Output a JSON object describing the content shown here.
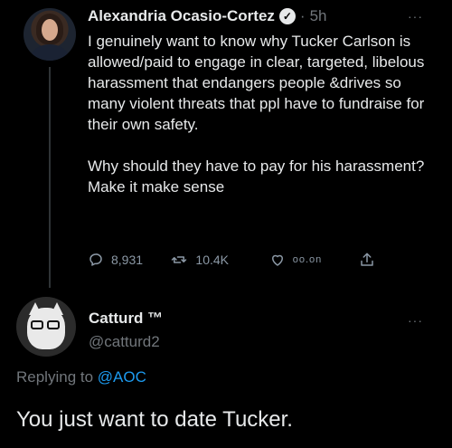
{
  "colors": {
    "background": "#000000",
    "text": "#e7e9ea",
    "secondary": "#71767b",
    "link": "#1d9bf0"
  },
  "tweet": {
    "author_name": "Alexandria Ocasio-Cortez",
    "separator": "·",
    "time": "5h",
    "body_para1": "I genuinely want to know why Tucker Carlson is allowed/paid to engage in clear, targeted, libelous harassment that endangers people &drives so many violent threats that ppl have to fundraise for their own safety.",
    "body_para2": "Why should they have to pay for his harassment? Make it make sense",
    "replies": "8,931",
    "retweets": "10.4K",
    "likes_partial": "oo.on",
    "more_label": "···"
  },
  "reply": {
    "author_name": "Catturd ™",
    "handle": "@catturd2",
    "replying_prefix": "Replying to",
    "replying_to": "@AOC",
    "body": "You just want to date Tucker.",
    "more_label": "···"
  },
  "icons": {
    "verified": "verified-badge-icon",
    "reply": "reply-icon",
    "retweet": "retweet-icon",
    "like": "heart-icon",
    "share": "share-icon"
  }
}
